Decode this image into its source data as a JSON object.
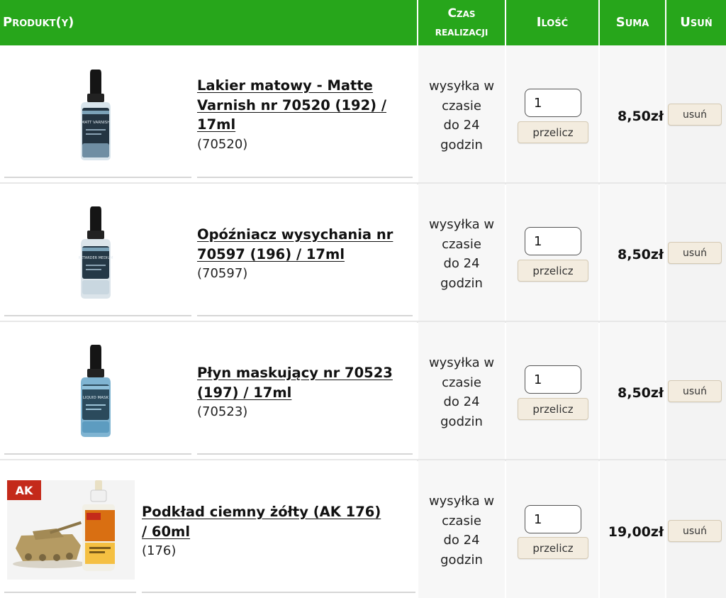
{
  "header": {
    "product": "Produkt(y)",
    "lead_time_line1": "Czas",
    "lead_time_line2": "realizacji",
    "quantity": "Ilość",
    "total": "Suma",
    "remove": "Usuń"
  },
  "items": [
    {
      "name_lines": [
        "Lakier matowy - Matte",
        "Varnish nr 70520 (192) /",
        "17ml"
      ],
      "code": "(70520)",
      "shipping_lines": [
        "wysyłka w",
        "czasie",
        "do 24",
        "godzin"
      ],
      "quantity": "1",
      "recalc_label": "przelicz",
      "price": "8,50zł",
      "remove_label": "usuń",
      "image": "dropper-bottle-matte-varnish",
      "bottle_label_text": "MATT VARNISH"
    },
    {
      "name_lines": [
        "Opóźniacz wysychania nr",
        "70597 (196) / 17ml"
      ],
      "code": "(70597)",
      "shipping_lines": [
        "wysyłka w",
        "czasie",
        "do 24",
        "godzin"
      ],
      "quantity": "1",
      "recalc_label": "przelicz",
      "price": "8,50zł",
      "remove_label": "usuń",
      "image": "dropper-bottle-retarder-medium",
      "bottle_label_text": "RETARDER MEDIUM"
    },
    {
      "name_lines": [
        "Płyn maskujący nr 70523",
        "(197) / 17ml"
      ],
      "code": "(70523)",
      "shipping_lines": [
        "wysyłka w",
        "czasie",
        "do 24",
        "godzin"
      ],
      "quantity": "1",
      "recalc_label": "przelicz",
      "price": "8,50zł",
      "remove_label": "usuń",
      "image": "dropper-bottle-liquid-mask",
      "bottle_label_text": "LIQUID MASK"
    },
    {
      "name_lines": [
        "Podkład ciemny żółty (AK 176)",
        "/ 60ml"
      ],
      "code": "(176)",
      "shipping_lines": [
        "wysyłka w",
        "czasie",
        "do 24",
        "godzin"
      ],
      "quantity": "1",
      "recalc_label": "przelicz",
      "price": "19,00zł",
      "remove_label": "usuń",
      "image": "ak-primer-bottle-with-tank-model",
      "bottle_label_text": "AK"
    }
  ],
  "colors": {
    "header_green": "#27a61b",
    "button_bg": "#f3ecdf",
    "cell_gray": "#f7f7f7"
  }
}
